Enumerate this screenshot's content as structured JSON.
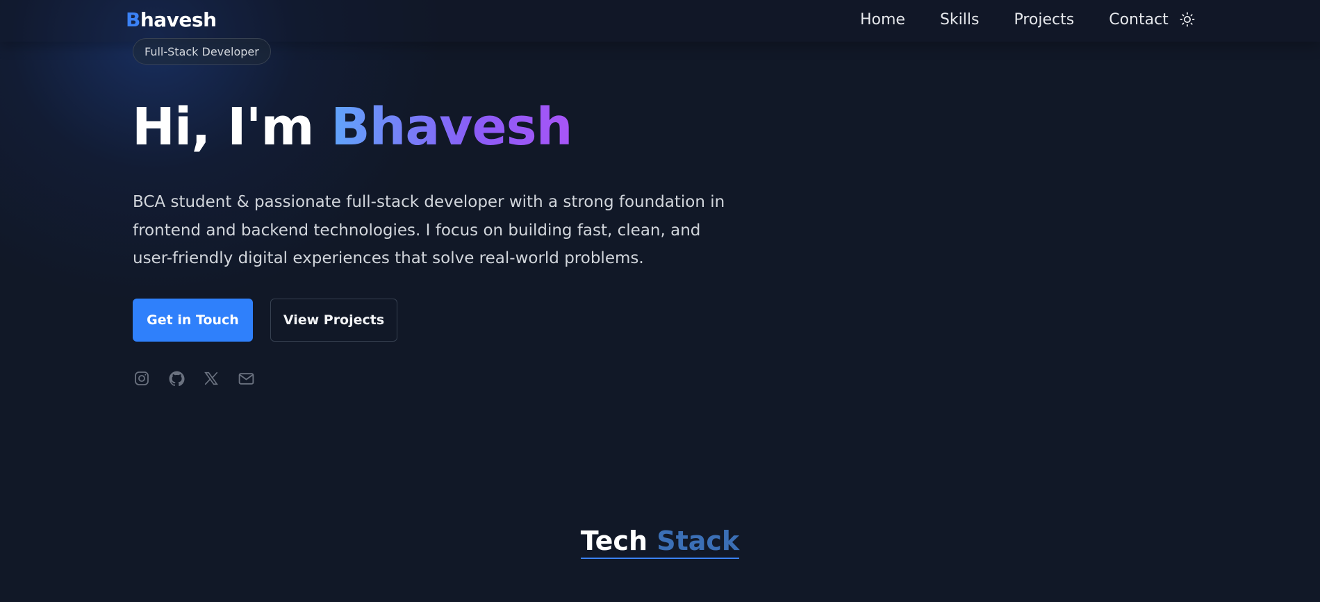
{
  "nav": {
    "logo_first": "B",
    "logo_rest": "havesh",
    "links": [
      "Home",
      "Skills",
      "Projects",
      "Contact"
    ],
    "theme_icon": "sun-icon"
  },
  "hero": {
    "badge": "Full-Stack Developer",
    "title_prefix": "Hi, I'm",
    "title_name": "Bhavesh",
    "description": "BCA student & passionate full-stack developer with a strong foundation in frontend and backend technologies. I focus on building fast, clean, and user-friendly digital experiences that solve real-world problems.",
    "primary_button": "Get in Touch",
    "secondary_button": "View Projects",
    "socials": [
      "instagram-icon",
      "github-icon",
      "x-icon",
      "mail-icon"
    ]
  },
  "tech_stack": {
    "title_word1": "Tech",
    "title_word2": "Stack"
  },
  "colors": {
    "background": "#111827",
    "accent": "#2f80fb",
    "gradient_start": "#60a5fa",
    "gradient_end": "#a855f7"
  }
}
